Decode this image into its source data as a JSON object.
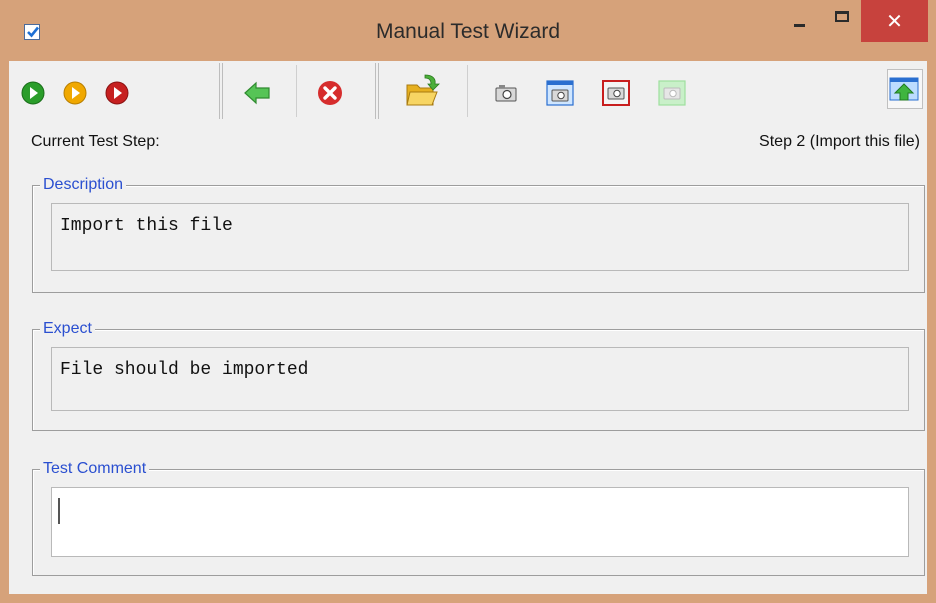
{
  "window": {
    "title": "Manual Test Wizard",
    "icons": {
      "app": "checkbox-icon",
      "minimize": "minimize-icon",
      "maximize": "maximize-icon",
      "close": "close-icon"
    },
    "close_glyph": "✕",
    "accent_close": "#c7423d"
  },
  "toolbar": {
    "buttons": [
      {
        "icon": "play-green-icon",
        "color": "#2a9d2a"
      },
      {
        "icon": "play-yellow-icon",
        "color": "#f0a800"
      },
      {
        "icon": "play-red-icon",
        "color": "#c62020"
      },
      {
        "icon": "back-arrow-icon",
        "color": "#3fb53f"
      },
      {
        "icon": "cancel-icon",
        "color": "#d62d2d"
      },
      {
        "icon": "open-folder-icon",
        "color": "#f2c230"
      },
      {
        "icon": "camera-icon"
      },
      {
        "icon": "camera-window-icon"
      },
      {
        "icon": "camera-red-frame-icon"
      },
      {
        "icon": "camera-green-disabled-icon"
      },
      {
        "icon": "upload-screen-icon"
      }
    ]
  },
  "status": {
    "current_step_label": "Current Test Step:",
    "current_step_value": "Step 2 (Import this file)"
  },
  "description": {
    "legend": "Description",
    "text": "Import this file"
  },
  "expect": {
    "legend": "Expect",
    "text": "File should be imported"
  },
  "comment": {
    "legend": "Test Comment",
    "text": ""
  }
}
